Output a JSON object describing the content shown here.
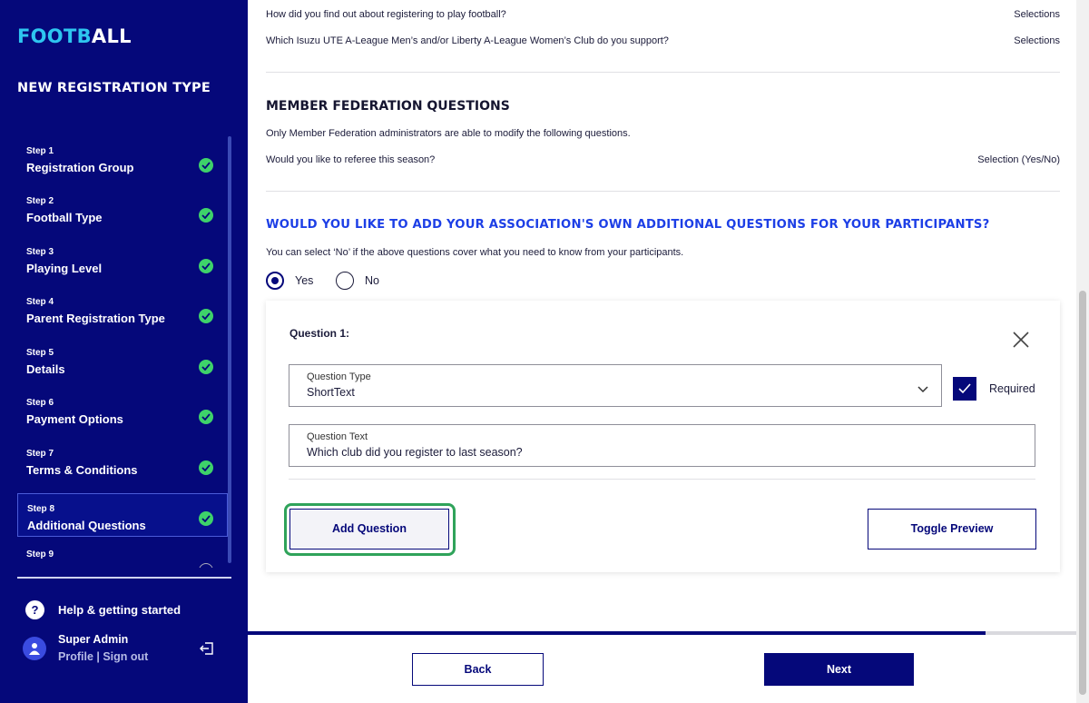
{
  "sidebar": {
    "logo_part1": "FOOTB",
    "logo_part2": "ALL",
    "title": "NEW REGISTRATION TYPE",
    "steps": [
      {
        "num": "Step 1",
        "name": "Registration Group",
        "done": true
      },
      {
        "num": "Step 2",
        "name": "Football Type",
        "done": true
      },
      {
        "num": "Step 3",
        "name": "Playing Level",
        "done": true
      },
      {
        "num": "Step 4",
        "name": "Parent Registration Type",
        "done": true
      },
      {
        "num": "Step 5",
        "name": "Details",
        "done": true
      },
      {
        "num": "Step 6",
        "name": "Payment Options",
        "done": true
      },
      {
        "num": "Step 7",
        "name": "Terms & Conditions",
        "done": true
      },
      {
        "num": "Step 8",
        "name": "Additional Questions",
        "done": true,
        "active": true
      },
      {
        "num": "Step 9",
        "name": "",
        "done": false
      }
    ],
    "help_label": "Help & getting started",
    "help_icon": "?",
    "user_name": "Super Admin",
    "user_links": "Profile | Sign out"
  },
  "main": {
    "top_questions": [
      {
        "text": "How did you find out about registering to play football?",
        "type": "Selections"
      },
      {
        "text": "Which Isuzu UTE A-League Men’s and/or Liberty A-League Women’s Club do you support?",
        "type": "Selections"
      }
    ],
    "mf_title": "MEMBER FEDERATION QUESTIONS",
    "mf_note": "Only Member Federation administrators are able to modify the following questions.",
    "mf_question": {
      "text": "Would you like to referee this season?",
      "type": "Selection (Yes/No)"
    },
    "assoc_title": "WOULD YOU LIKE TO ADD YOUR ASSOCIATION'S OWN ADDITIONAL QUESTIONS FOR YOUR PARTICIPANTS?",
    "assoc_note": "You can select ‘No’ if the above questions cover what you need to know from your participants.",
    "radio_yes": "Yes",
    "radio_no": "No",
    "radio_selected": "Yes",
    "question_card": {
      "title": "Question 1:",
      "type_label": "Question Type",
      "type_value": "ShortText",
      "required_label": "Required",
      "required_checked": true,
      "text_label": "Question Text",
      "text_value": "Which club did you register to last season?",
      "add_button": "Add Question",
      "toggle_button": "Toggle Preview"
    }
  },
  "footer": {
    "back": "Back",
    "next": "Next",
    "progress": 0.89
  },
  "colors": {
    "sidebar_bg": "#05087a",
    "logo_accent": "#2ec6f0",
    "heading_blue": "#1d3fe6",
    "check_green": "#3ed26a",
    "highlight_green": "#2fa35a"
  }
}
